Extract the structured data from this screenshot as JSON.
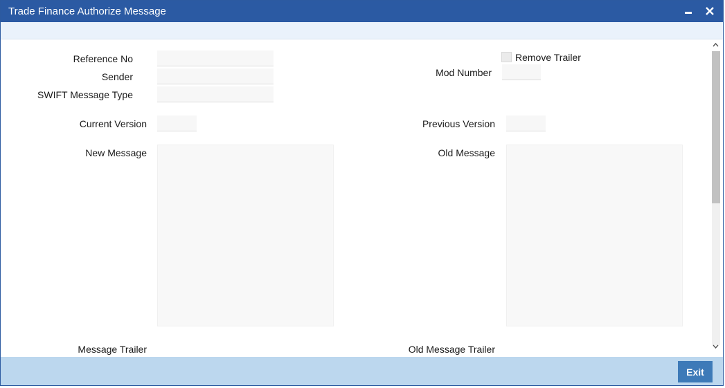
{
  "window": {
    "title": "Trade Finance Authorize Message",
    "minimize_icon": "minimize-icon",
    "close_icon": "close-icon"
  },
  "form": {
    "reference_no": {
      "label": "Reference No",
      "value": ""
    },
    "sender": {
      "label": "Sender",
      "value": ""
    },
    "swift_message_type": {
      "label": "SWIFT Message Type",
      "value": ""
    },
    "remove_trailer": {
      "label": "Remove Trailer",
      "checked": false
    },
    "mod_number": {
      "label": "Mod Number",
      "value": ""
    },
    "current_version": {
      "label": "Current Version",
      "value": ""
    },
    "previous_version": {
      "label": "Previous Version",
      "value": ""
    },
    "new_message": {
      "label": "New Message",
      "value": ""
    },
    "old_message": {
      "label": "Old Message",
      "value": ""
    },
    "message_trailer": {
      "label": "Message Trailer"
    },
    "old_message_trailer": {
      "label": "Old Message Trailer"
    }
  },
  "footer": {
    "exit_label": "Exit"
  },
  "colors": {
    "titlebar": "#2b5aa3",
    "footer": "#bcd7ee",
    "exit_button": "#3d7ab8"
  }
}
